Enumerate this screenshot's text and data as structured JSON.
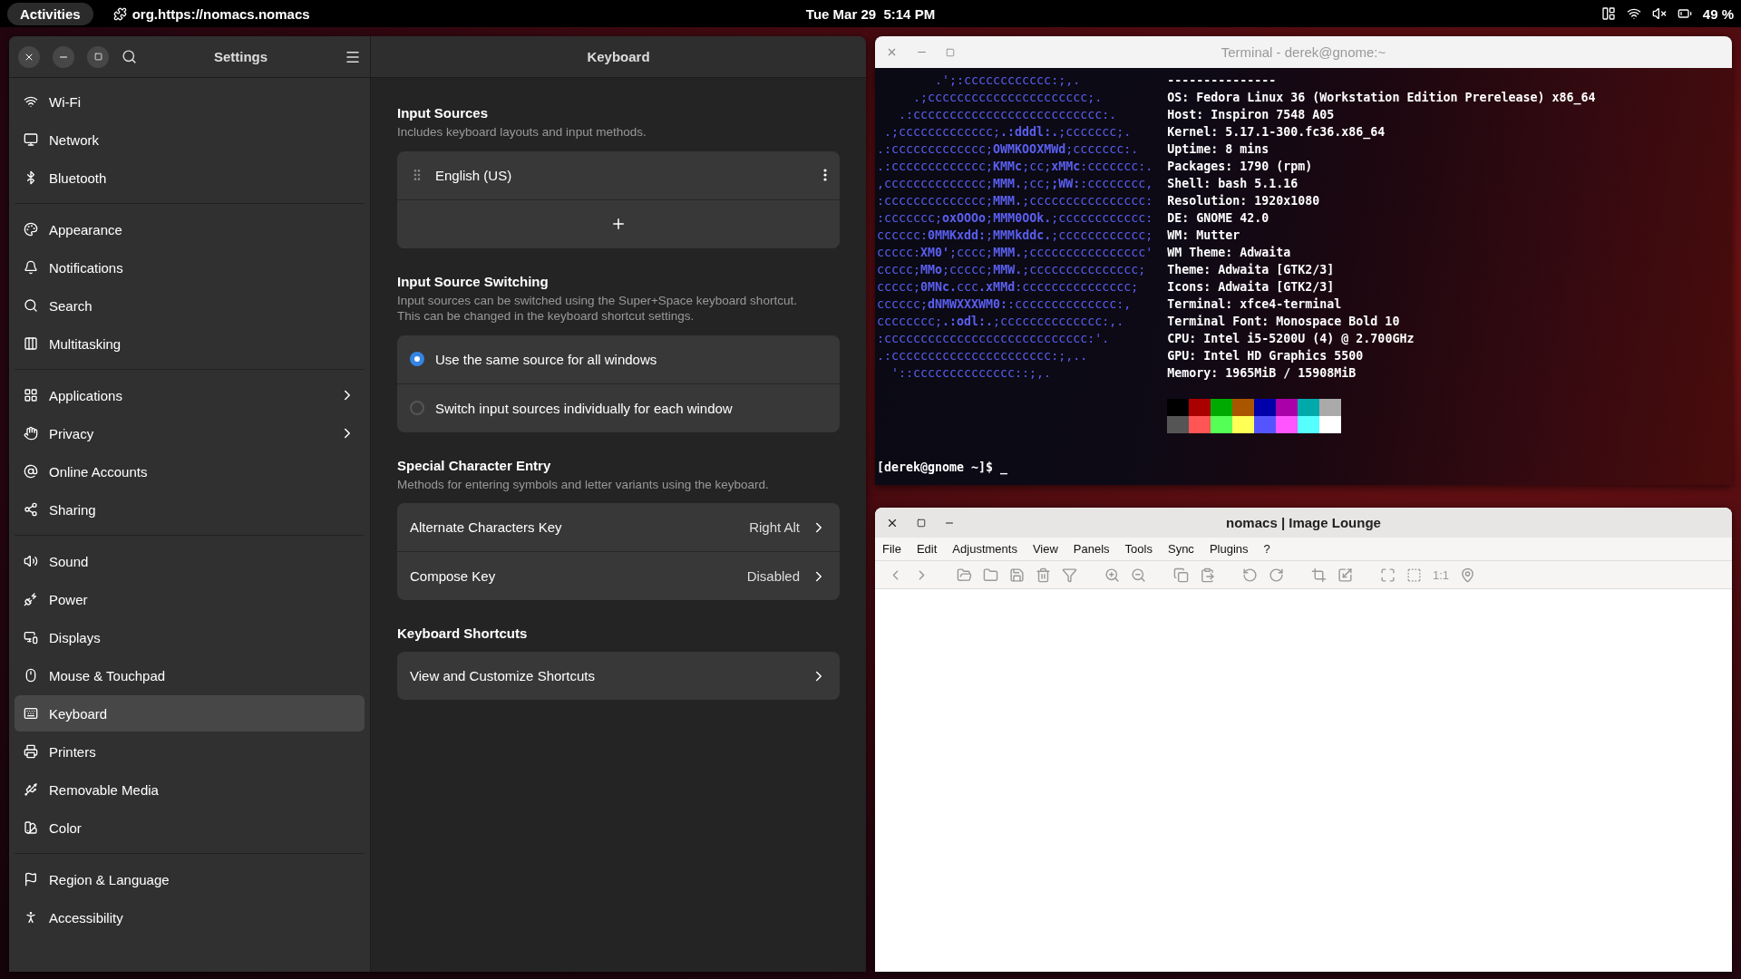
{
  "top_bar": {
    "activities": "Activities",
    "app_name": "org.https://nomacs.nomacs",
    "clock": "Tue Mar 29  5:14 PM",
    "battery": "49 %"
  },
  "settings": {
    "title": "Settings",
    "page_title": "Keyboard",
    "sidebar": [
      {
        "items": [
          {
            "label": "Wi-Fi",
            "selected": false,
            "submenu": false
          },
          {
            "label": "Network",
            "selected": false,
            "submenu": false
          },
          {
            "label": "Bluetooth",
            "selected": false,
            "submenu": false
          }
        ]
      },
      {
        "items": [
          {
            "label": "Appearance",
            "selected": false,
            "submenu": false
          },
          {
            "label": "Notifications",
            "selected": false,
            "submenu": false
          },
          {
            "label": "Search",
            "selected": false,
            "submenu": false
          },
          {
            "label": "Multitasking",
            "selected": false,
            "submenu": false
          }
        ]
      },
      {
        "items": [
          {
            "label": "Applications",
            "selected": false,
            "submenu": true
          },
          {
            "label": "Privacy",
            "selected": false,
            "submenu": true
          },
          {
            "label": "Online Accounts",
            "selected": false,
            "submenu": false
          },
          {
            "label": "Sharing",
            "selected": false,
            "submenu": false
          }
        ]
      },
      {
        "items": [
          {
            "label": "Sound",
            "selected": false,
            "submenu": false
          },
          {
            "label": "Power",
            "selected": false,
            "submenu": false
          },
          {
            "label": "Displays",
            "selected": false,
            "submenu": false
          },
          {
            "label": "Mouse & Touchpad",
            "selected": false,
            "submenu": false
          },
          {
            "label": "Keyboard",
            "selected": true,
            "submenu": false
          },
          {
            "label": "Printers",
            "selected": false,
            "submenu": false
          },
          {
            "label": "Removable Media",
            "selected": false,
            "submenu": false
          },
          {
            "label": "Color",
            "selected": false,
            "submenu": false
          }
        ]
      },
      {
        "items": [
          {
            "label": "Region & Language",
            "selected": false,
            "submenu": false
          },
          {
            "label": "Accessibility",
            "selected": false,
            "submenu": false
          }
        ]
      }
    ],
    "input_sources": {
      "heading": "Input Sources",
      "description": "Includes keyboard layouts and input methods.",
      "sources": [
        "English (US)"
      ]
    },
    "switching": {
      "heading": "Input Source Switching",
      "description": "Input sources can be switched using the Super+Space keyboard shortcut.\nThis can be changed in the keyboard shortcut settings.",
      "options": [
        {
          "label": "Use the same source for all windows",
          "selected": true
        },
        {
          "label": "Switch input sources individually for each window",
          "selected": false
        }
      ]
    },
    "special": {
      "heading": "Special Character Entry",
      "description": "Methods for entering symbols and letter variants using the keyboard.",
      "rows": [
        {
          "label": "Alternate Characters Key",
          "value": "Right Alt"
        },
        {
          "label": "Compose Key",
          "value": "Disabled"
        }
      ]
    },
    "shortcuts": {
      "heading": "Keyboard Shortcuts",
      "rows": [
        {
          "label": "View and Customize Shortcuts"
        }
      ]
    }
  },
  "terminal": {
    "title": "Terminal - derek@gnome:~",
    "art": [
      "        .';:cccccccccccc:;,.",
      "     .;cccccccccccccccccccccc;.",
      "   .:cccccccccccccccccccccccccc:.",
      " .;ccccccccccccc;**.:dddl:.**;ccccccc;.",
      ".:ccccccccccccc;**OWMKOOXMWd**;ccccccc:.",
      ".:ccccccccccccc;**KMMc**;cc;**xMMc**:ccccccc:.",
      ",cccccccccccccc;**MMM.**;cc;**;WW:**:cccccccc,",
      ":cccccccccccccc;**MMM.**;cccccccccccccccc:",
      ":ccccccc;**oxOOOo**;**MMM0OOk.**;cccccccccccc:",
      "cccccc:**0MMKxdd:**;**MMMkddc.**;cccccccccccc;",
      "ccccc:**XM0'**;cccc;**MMM.**;cccccccccccccccc'",
      "ccccc;**MMo**;ccccc;**MMW.**;ccccccccccccccc;",
      "ccccc;**0MNc.**ccc**.xMMd**:ccccccccccccccc;",
      "cccccc;**dNMWXXXWM0:**:cccccccccccccc:,",
      "cccccccc;**.:odl:.**;cccccccccccccc:,.",
      ":cccccccccccccccccccccccccccc:'.",
      ".:cccccccccccccccccccccc:;,..",
      "  '::cccccccccccccc::;,."
    ],
    "info": [
      "---------------",
      "**OS**: Fedora Linux 36 (Workstation Edition Prerelease) x86_64",
      "**Host**: Inspiron 7548 A05",
      "**Kernel**: 5.17.1-300.fc36.x86_64",
      "**Uptime**: 8 mins",
      "**Packages**: 1790 (rpm)",
      "**Shell**: bash 5.1.16",
      "**Resolution**: 1920x1080",
      "**DE**: GNOME 42.0",
      "**WM**: Mutter",
      "**WM Theme**: Adwaita",
      "**Theme**: Adwaita [GTK2/3]",
      "**Icons**: Adwaita [GTK2/3]",
      "**Terminal**: xfce4-terminal",
      "**Terminal Font**: Monospace Bold 10",
      "**CPU**: Intel i5-5200U (4) @ 2.700GHz",
      "**GPU**: Intel HD Graphics 5500",
      "**Memory**: 1965MiB / 15908MiB"
    ],
    "swatches": [
      {
        "color": "#000000"
      },
      {
        "color": "#aa0000"
      },
      {
        "color": "#00aa00"
      },
      {
        "color": "#aa5500"
      },
      {
        "color": "#0000aa"
      },
      {
        "color": "#aa00aa"
      },
      {
        "color": "#00aaaa"
      },
      {
        "color": "#aaaaaa"
      },
      {
        "color": "#555555"
      },
      {
        "color": "#ff5555"
      },
      {
        "color": "#55ff55"
      },
      {
        "color": "#ffff55"
      },
      {
        "color": "#5555ff"
      },
      {
        "color": "#ff55ff"
      },
      {
        "color": "#55ffff"
      },
      {
        "color": "#ffffff"
      }
    ],
    "prompt": "[derek@gnome ~]$ _"
  },
  "nomacs": {
    "title": "nomacs | Image Lounge",
    "menu": [
      "File",
      "Edit",
      "Adjustments",
      "View",
      "Panels",
      "Tools",
      "Sync",
      "Plugins",
      "?"
    ],
    "zoom_label": "1:1"
  }
}
